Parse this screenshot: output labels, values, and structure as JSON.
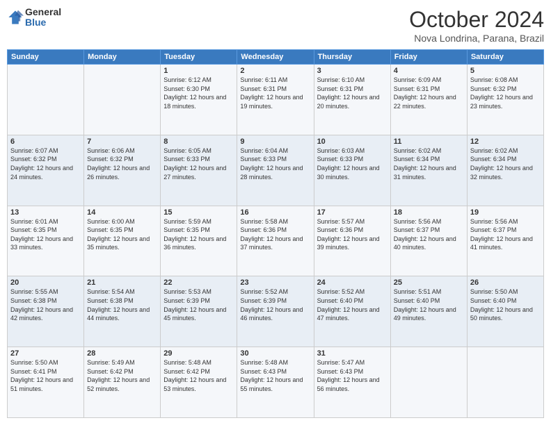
{
  "logo": {
    "general": "General",
    "blue": "Blue"
  },
  "header": {
    "month": "October 2024",
    "location": "Nova Londrina, Parana, Brazil"
  },
  "days_of_week": [
    "Sunday",
    "Monday",
    "Tuesday",
    "Wednesday",
    "Thursday",
    "Friday",
    "Saturday"
  ],
  "weeks": [
    [
      {
        "day": "",
        "sunrise": "",
        "sunset": "",
        "daylight": ""
      },
      {
        "day": "",
        "sunrise": "",
        "sunset": "",
        "daylight": ""
      },
      {
        "day": "1",
        "sunrise": "Sunrise: 6:12 AM",
        "sunset": "Sunset: 6:30 PM",
        "daylight": "Daylight: 12 hours and 18 minutes."
      },
      {
        "day": "2",
        "sunrise": "Sunrise: 6:11 AM",
        "sunset": "Sunset: 6:31 PM",
        "daylight": "Daylight: 12 hours and 19 minutes."
      },
      {
        "day": "3",
        "sunrise": "Sunrise: 6:10 AM",
        "sunset": "Sunset: 6:31 PM",
        "daylight": "Daylight: 12 hours and 20 minutes."
      },
      {
        "day": "4",
        "sunrise": "Sunrise: 6:09 AM",
        "sunset": "Sunset: 6:31 PM",
        "daylight": "Daylight: 12 hours and 22 minutes."
      },
      {
        "day": "5",
        "sunrise": "Sunrise: 6:08 AM",
        "sunset": "Sunset: 6:32 PM",
        "daylight": "Daylight: 12 hours and 23 minutes."
      }
    ],
    [
      {
        "day": "6",
        "sunrise": "Sunrise: 6:07 AM",
        "sunset": "Sunset: 6:32 PM",
        "daylight": "Daylight: 12 hours and 24 minutes."
      },
      {
        "day": "7",
        "sunrise": "Sunrise: 6:06 AM",
        "sunset": "Sunset: 6:32 PM",
        "daylight": "Daylight: 12 hours and 26 minutes."
      },
      {
        "day": "8",
        "sunrise": "Sunrise: 6:05 AM",
        "sunset": "Sunset: 6:33 PM",
        "daylight": "Daylight: 12 hours and 27 minutes."
      },
      {
        "day": "9",
        "sunrise": "Sunrise: 6:04 AM",
        "sunset": "Sunset: 6:33 PM",
        "daylight": "Daylight: 12 hours and 28 minutes."
      },
      {
        "day": "10",
        "sunrise": "Sunrise: 6:03 AM",
        "sunset": "Sunset: 6:33 PM",
        "daylight": "Daylight: 12 hours and 30 minutes."
      },
      {
        "day": "11",
        "sunrise": "Sunrise: 6:02 AM",
        "sunset": "Sunset: 6:34 PM",
        "daylight": "Daylight: 12 hours and 31 minutes."
      },
      {
        "day": "12",
        "sunrise": "Sunrise: 6:02 AM",
        "sunset": "Sunset: 6:34 PM",
        "daylight": "Daylight: 12 hours and 32 minutes."
      }
    ],
    [
      {
        "day": "13",
        "sunrise": "Sunrise: 6:01 AM",
        "sunset": "Sunset: 6:35 PM",
        "daylight": "Daylight: 12 hours and 33 minutes."
      },
      {
        "day": "14",
        "sunrise": "Sunrise: 6:00 AM",
        "sunset": "Sunset: 6:35 PM",
        "daylight": "Daylight: 12 hours and 35 minutes."
      },
      {
        "day": "15",
        "sunrise": "Sunrise: 5:59 AM",
        "sunset": "Sunset: 6:35 PM",
        "daylight": "Daylight: 12 hours and 36 minutes."
      },
      {
        "day": "16",
        "sunrise": "Sunrise: 5:58 AM",
        "sunset": "Sunset: 6:36 PM",
        "daylight": "Daylight: 12 hours and 37 minutes."
      },
      {
        "day": "17",
        "sunrise": "Sunrise: 5:57 AM",
        "sunset": "Sunset: 6:36 PM",
        "daylight": "Daylight: 12 hours and 39 minutes."
      },
      {
        "day": "18",
        "sunrise": "Sunrise: 5:56 AM",
        "sunset": "Sunset: 6:37 PM",
        "daylight": "Daylight: 12 hours and 40 minutes."
      },
      {
        "day": "19",
        "sunrise": "Sunrise: 5:56 AM",
        "sunset": "Sunset: 6:37 PM",
        "daylight": "Daylight: 12 hours and 41 minutes."
      }
    ],
    [
      {
        "day": "20",
        "sunrise": "Sunrise: 5:55 AM",
        "sunset": "Sunset: 6:38 PM",
        "daylight": "Daylight: 12 hours and 42 minutes."
      },
      {
        "day": "21",
        "sunrise": "Sunrise: 5:54 AM",
        "sunset": "Sunset: 6:38 PM",
        "daylight": "Daylight: 12 hours and 44 minutes."
      },
      {
        "day": "22",
        "sunrise": "Sunrise: 5:53 AM",
        "sunset": "Sunset: 6:39 PM",
        "daylight": "Daylight: 12 hours and 45 minutes."
      },
      {
        "day": "23",
        "sunrise": "Sunrise: 5:52 AM",
        "sunset": "Sunset: 6:39 PM",
        "daylight": "Daylight: 12 hours and 46 minutes."
      },
      {
        "day": "24",
        "sunrise": "Sunrise: 5:52 AM",
        "sunset": "Sunset: 6:40 PM",
        "daylight": "Daylight: 12 hours and 47 minutes."
      },
      {
        "day": "25",
        "sunrise": "Sunrise: 5:51 AM",
        "sunset": "Sunset: 6:40 PM",
        "daylight": "Daylight: 12 hours and 49 minutes."
      },
      {
        "day": "26",
        "sunrise": "Sunrise: 5:50 AM",
        "sunset": "Sunset: 6:40 PM",
        "daylight": "Daylight: 12 hours and 50 minutes."
      }
    ],
    [
      {
        "day": "27",
        "sunrise": "Sunrise: 5:50 AM",
        "sunset": "Sunset: 6:41 PM",
        "daylight": "Daylight: 12 hours and 51 minutes."
      },
      {
        "day": "28",
        "sunrise": "Sunrise: 5:49 AM",
        "sunset": "Sunset: 6:42 PM",
        "daylight": "Daylight: 12 hours and 52 minutes."
      },
      {
        "day": "29",
        "sunrise": "Sunrise: 5:48 AM",
        "sunset": "Sunset: 6:42 PM",
        "daylight": "Daylight: 12 hours and 53 minutes."
      },
      {
        "day": "30",
        "sunrise": "Sunrise: 5:48 AM",
        "sunset": "Sunset: 6:43 PM",
        "daylight": "Daylight: 12 hours and 55 minutes."
      },
      {
        "day": "31",
        "sunrise": "Sunrise: 5:47 AM",
        "sunset": "Sunset: 6:43 PM",
        "daylight": "Daylight: 12 hours and 56 minutes."
      },
      {
        "day": "",
        "sunrise": "",
        "sunset": "",
        "daylight": ""
      },
      {
        "day": "",
        "sunrise": "",
        "sunset": "",
        "daylight": ""
      }
    ]
  ]
}
